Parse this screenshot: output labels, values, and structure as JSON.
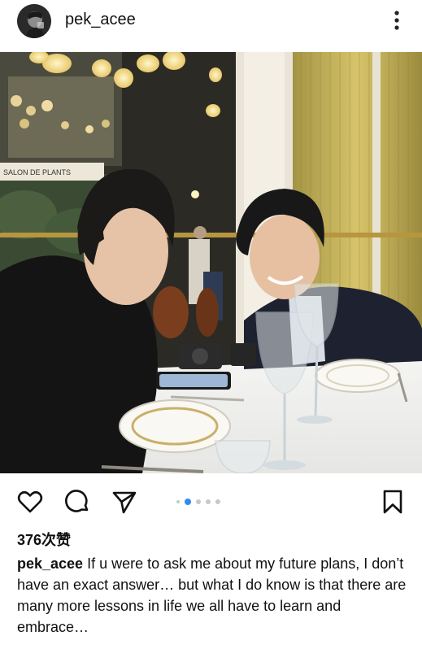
{
  "post": {
    "username": "pek_acee",
    "likes": "376次赞",
    "caption_username": "pek_acee",
    "caption_text": "If u were to ask me about my future plans, I don’t have an exact answer… but what I do know is that there are many more lessons in life we all have to learn and embrace…",
    "photo_sign_text": "SALON DE PLANTS"
  },
  "carousel": {
    "total": 5,
    "active_index": 1
  },
  "icons": {
    "more": "more-vertical-icon",
    "like": "heart-icon",
    "comment": "comment-icon",
    "share": "send-icon",
    "save": "bookmark-icon"
  },
  "colors": {
    "accent": "#2f8cf0",
    "text": "#111111",
    "background": "#ffffff"
  }
}
